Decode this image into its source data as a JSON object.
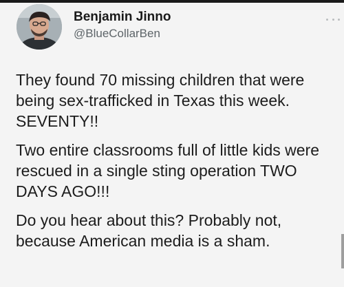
{
  "author": {
    "name": "Benjamin Jinno",
    "handle": "@BlueCollarBen"
  },
  "tweet": {
    "paragraphs": [
      "They found 70 missing children that were being sex-trafficked in Texas this week. SEVENTY!!",
      "Two entire classrooms full of little kids were rescued in a single sting operation TWO DAYS AGO!!!",
      "Do you hear about this? Probably not, because American media is a sham."
    ]
  },
  "icons": {
    "more": "more-horizontal-icon"
  },
  "colors": {
    "background": "#f4f4f4",
    "text": "#1c1c1c",
    "handle": "#5d6468"
  }
}
